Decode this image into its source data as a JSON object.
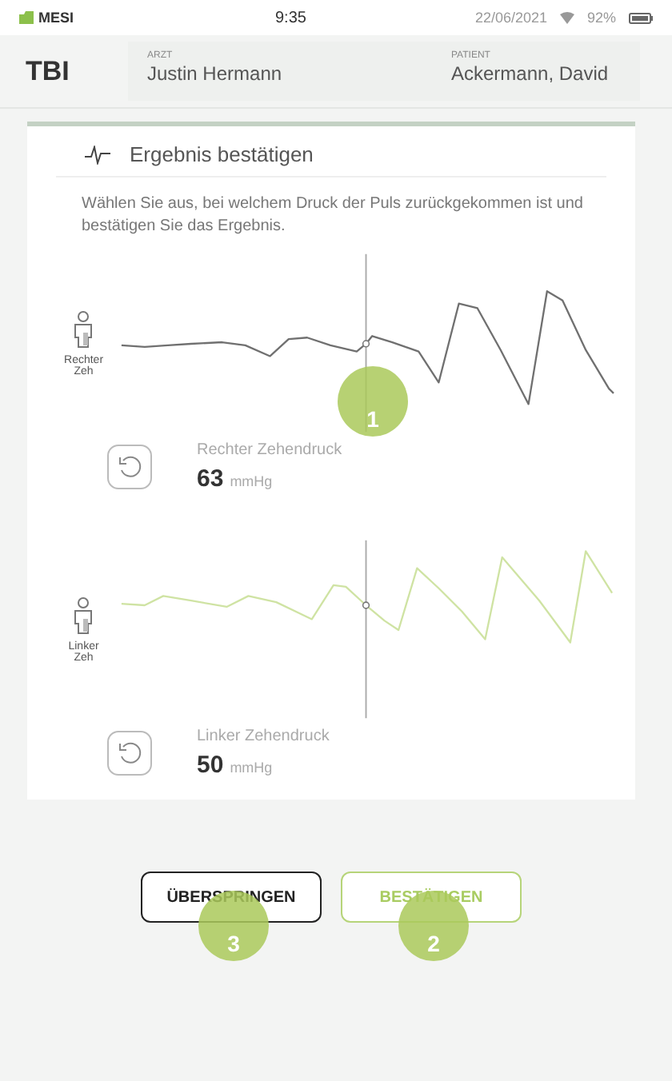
{
  "status_bar": {
    "brand": "MESI",
    "time": "9:35",
    "date": "22/06/2021",
    "battery": "92%"
  },
  "header": {
    "title": "TBI",
    "fields": [
      {
        "label": "ARZT",
        "value": "Justin Hermann"
      },
      {
        "label": "PATIENT",
        "value": "Ackermann, David"
      }
    ]
  },
  "card": {
    "title": "Ergebnis bestätigen",
    "instruction": "Wählen Sie aus, bei welchem Druck der Puls zurückgekommen ist und bestätigen Sie das Ergebnis.",
    "measurements": [
      {
        "site": "Rechter Zeh",
        "label": "Rechter Zehendruck",
        "value": "63",
        "unit": "mmHg",
        "color": "#707070",
        "marker": "1"
      },
      {
        "site": "Linker Zeh",
        "label": "Linker Zehendruck",
        "value": "50",
        "unit": "mmHg",
        "color": "#cfe3a3"
      }
    ]
  },
  "buttons": [
    {
      "label": "ÜBERSPRINGEN",
      "kind": "secondary",
      "marker": "3"
    },
    {
      "label": "BESTÄTIGEN",
      "kind": "primary",
      "marker": "2"
    }
  ]
}
